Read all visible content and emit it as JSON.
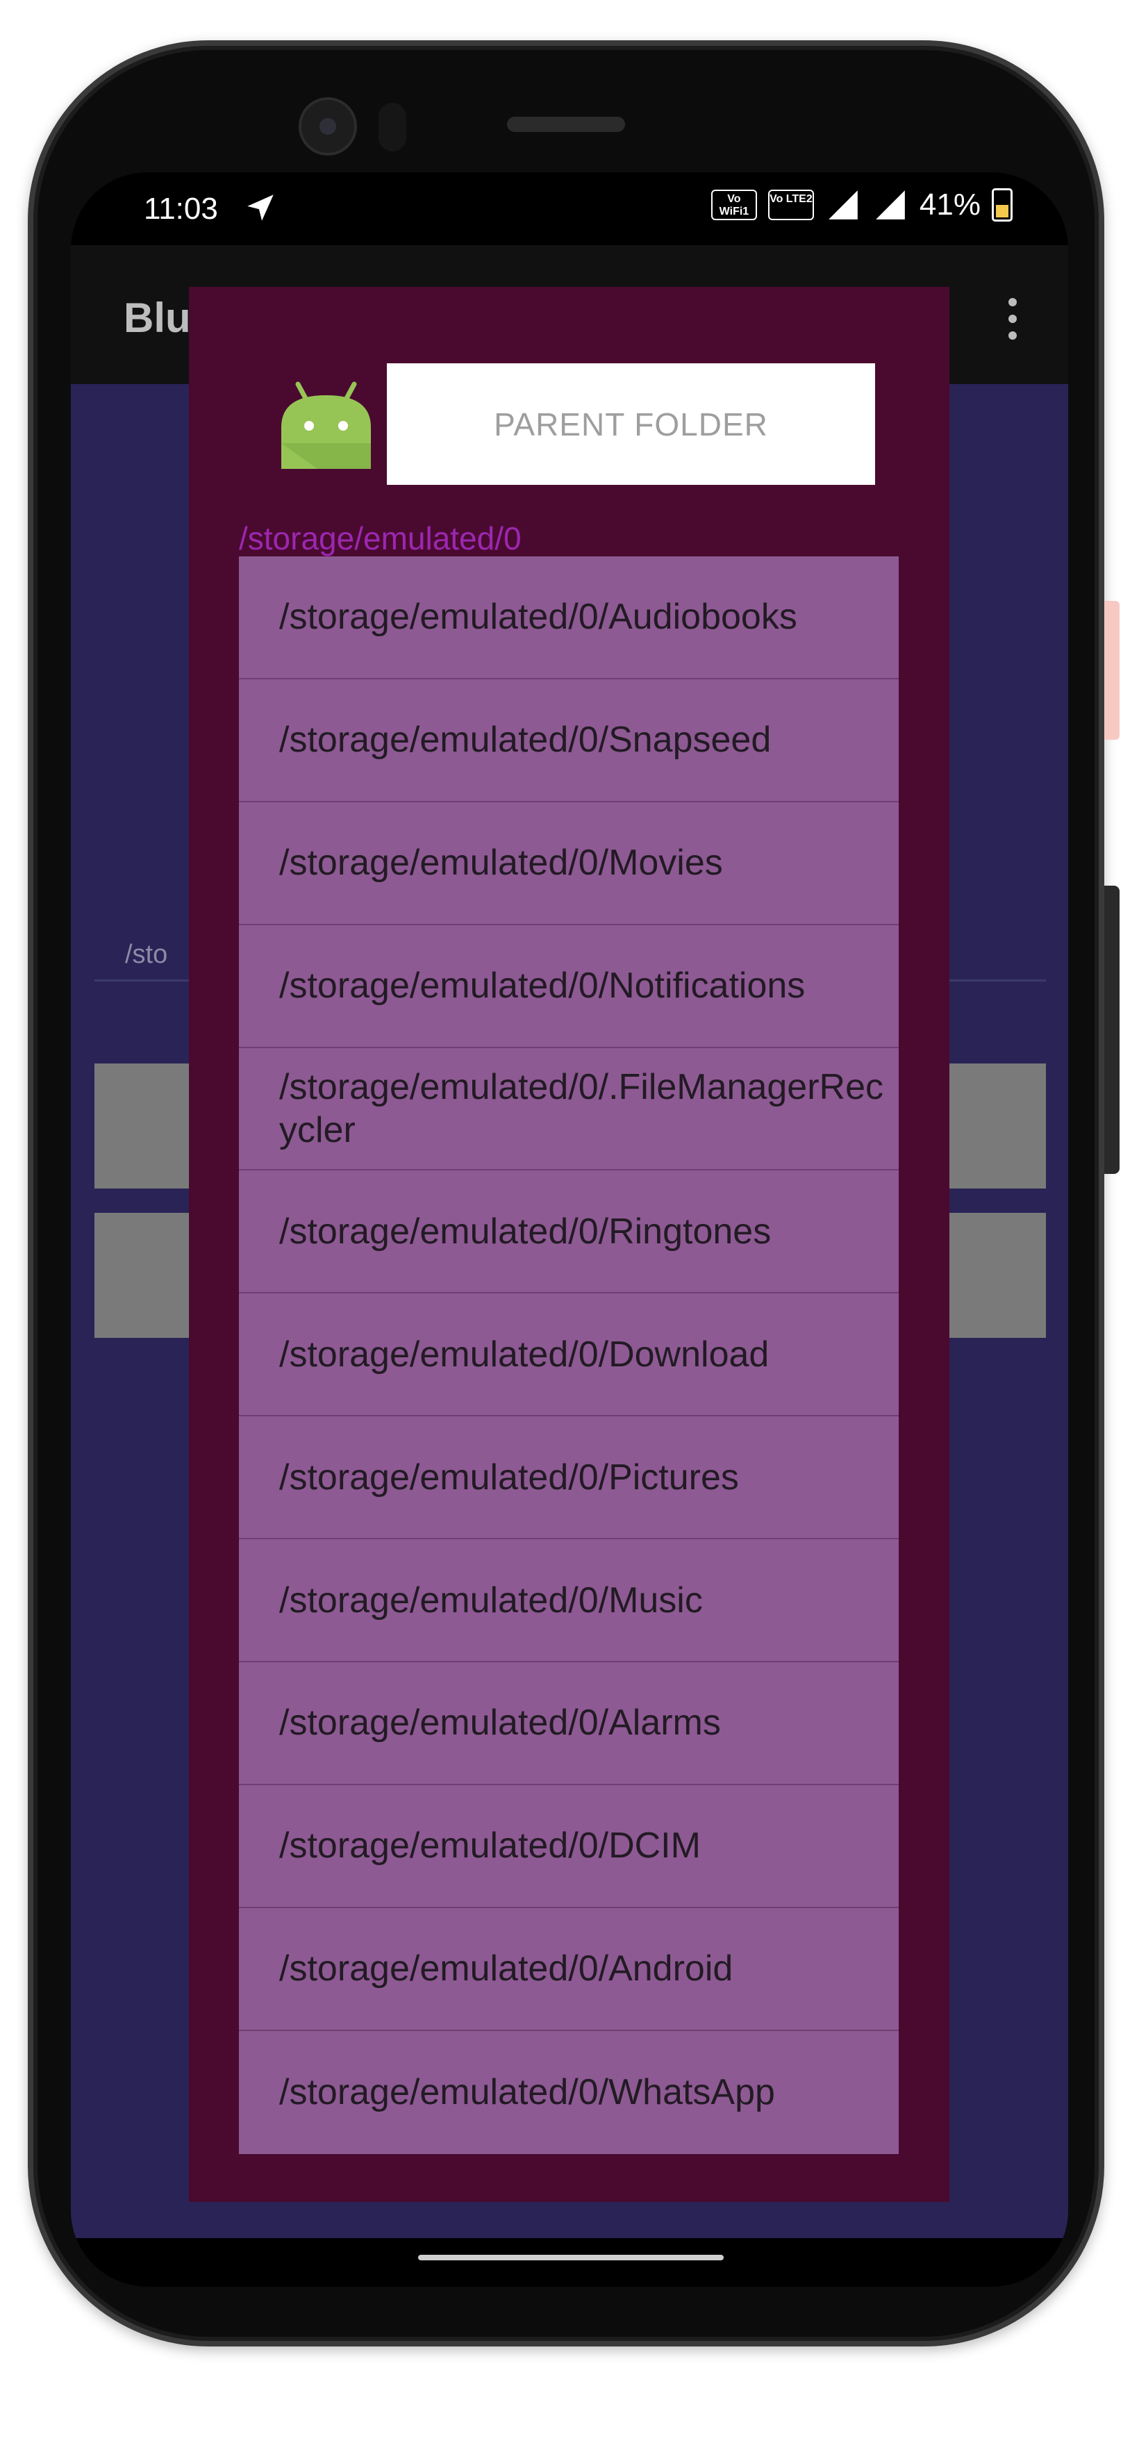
{
  "status_bar": {
    "time": "11:03",
    "wifi_badge": "Vo WiFi1",
    "lte_badge": "Vo LTE2",
    "battery": "41%"
  },
  "app_bar": {
    "title": "Blu"
  },
  "background": {
    "path_hint": "/sto"
  },
  "dialog": {
    "parent_button": "PARENT FOLDER",
    "current_path": "/storage/emulated/0",
    "folders": [
      "/storage/emulated/0/Audiobooks",
      "/storage/emulated/0/Snapseed",
      "/storage/emulated/0/Movies",
      "/storage/emulated/0/Notifications",
      "/storage/emulated/0/.FileManagerRecycler",
      "/storage/emulated/0/Ringtones",
      "/storage/emulated/0/Download",
      "/storage/emulated/0/Pictures",
      "/storage/emulated/0/Music",
      "/storage/emulated/0/Alarms",
      "/storage/emulated/0/DCIM",
      "/storage/emulated/0/Android",
      "/storage/emulated/0/WhatsApp"
    ]
  },
  "colors": {
    "dialog_bg": "#4a0a30",
    "list_bg": "#8e5a93",
    "path_accent": "#9c27b0",
    "screen_bg": "#2a2356",
    "android_green": "#97c555"
  },
  "icons": [
    "navigation-arrow-icon",
    "wifi-calling-icon",
    "lte-icon",
    "signal-icon",
    "battery-icon",
    "overflow-menu-icon",
    "android-icon"
  ]
}
